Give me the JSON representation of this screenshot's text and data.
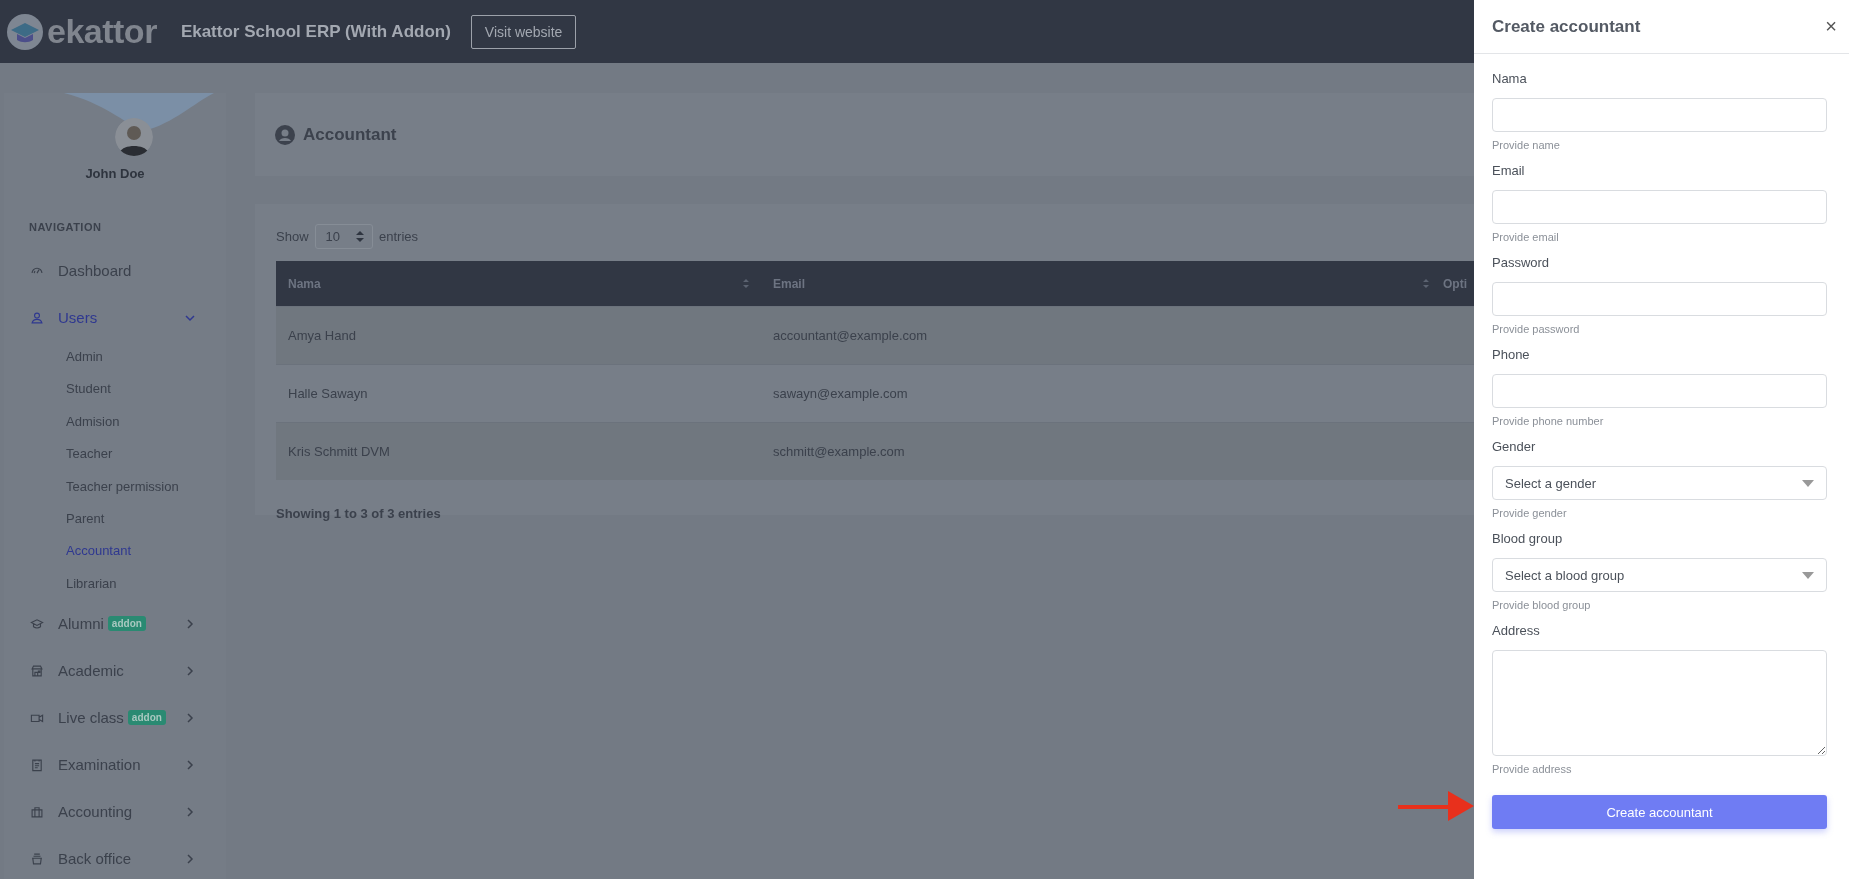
{
  "header": {
    "logo_text": "ekattor",
    "app_title": "Ekattor School ERP (With Addon)",
    "visit_button": "Visit website"
  },
  "sidebar": {
    "user_name": "John Doe",
    "section_label": "NAVIGATION",
    "items": [
      {
        "label": "Dashboard"
      },
      {
        "label": "Users",
        "expanded": true,
        "children": [
          {
            "label": "Admin",
            "selected": false
          },
          {
            "label": "Student",
            "selected": false
          },
          {
            "label": "Admision",
            "selected": false
          },
          {
            "label": "Teacher",
            "selected": false
          },
          {
            "label": "Teacher permission",
            "selected": false
          },
          {
            "label": "Parent",
            "selected": false
          },
          {
            "label": "Accountant",
            "selected": true
          },
          {
            "label": "Librarian",
            "selected": false
          }
        ]
      },
      {
        "label": "Alumni",
        "badge": "addon",
        "expanded": false
      },
      {
        "label": "Academic",
        "expanded": false
      },
      {
        "label": "Live class",
        "badge": "addon",
        "expanded": false
      },
      {
        "label": "Examination",
        "expanded": false
      },
      {
        "label": "Accounting",
        "expanded": false
      },
      {
        "label": "Back office",
        "expanded": false
      }
    ]
  },
  "page": {
    "title": "Accountant"
  },
  "table": {
    "show_label": "Show",
    "page_length": "10",
    "entries_label": "entries",
    "columns": [
      {
        "label": "Nama"
      },
      {
        "label": "Email"
      },
      {
        "label": "Opti"
      }
    ],
    "rows": [
      {
        "name": "Amya Hand",
        "email": "accountant@example.com"
      },
      {
        "name": "Halle Sawayn",
        "email": "sawayn@example.com"
      },
      {
        "name": "Kris Schmitt DVM",
        "email": "schmitt@example.com"
      }
    ],
    "info": "Showing 1 to 3 of 3 entries"
  },
  "drawer": {
    "title": "Create accountant",
    "close": "×",
    "fields": [
      {
        "kind": "text",
        "label": "Nama",
        "hint": "Provide name"
      },
      {
        "kind": "text",
        "label": "Email",
        "hint": "Provide email"
      },
      {
        "kind": "text",
        "label": "Password",
        "hint": "Provide password"
      },
      {
        "kind": "text",
        "label": "Phone",
        "hint": "Provide phone number"
      },
      {
        "kind": "select",
        "label": "Gender",
        "value": "Select a gender",
        "hint": "Provide gender"
      },
      {
        "kind": "select",
        "label": "Blood group",
        "value": "Select a blood group",
        "hint": "Provide blood group"
      },
      {
        "kind": "textarea",
        "label": "Address",
        "hint": "Provide address"
      }
    ],
    "submit": "Create accountant"
  }
}
